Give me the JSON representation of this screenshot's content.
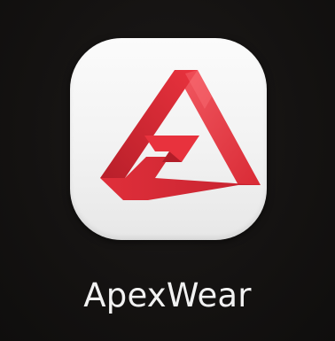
{
  "app": {
    "name": "ApexWear",
    "icon": "apexwear-penrose-triangle-logo",
    "brand_colors": {
      "primary": "#e8323d",
      "dark": "#b81f2a",
      "light": "#f25a62",
      "tile_background": "#f4f4f4"
    }
  },
  "screen": {
    "background": "#141211"
  }
}
